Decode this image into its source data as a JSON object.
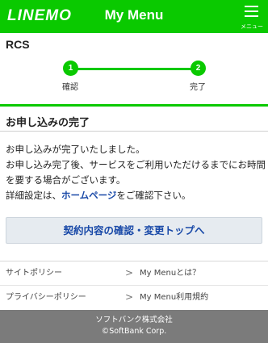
{
  "header": {
    "logo": "LINEMO",
    "title": "My Menu",
    "menu_label": "メニュー"
  },
  "service_name": "RCS",
  "stepper": {
    "steps": [
      {
        "number": "1",
        "label": "確認"
      },
      {
        "number": "2",
        "label": "完了"
      }
    ]
  },
  "section": {
    "title": "お申し込みの完了"
  },
  "body": {
    "line1": "お申し込みが完了いたしました。",
    "line2": "お申し込み完了後、サービスをご利用いただけるまでにお時間を要する場合がございます。",
    "line3_prefix": "詳細設定は、",
    "line3_link": "ホームページ",
    "line3_suffix": "をご確認下さい。"
  },
  "primary_button": "契約内容の確認・変更トップへ",
  "footer_links": [
    {
      "label": "サイトポリシー"
    },
    {
      "label": "My Menuとは？"
    },
    {
      "label": "プライバシーポリシー"
    },
    {
      "label": "My Menu利用規約"
    }
  ],
  "footer": {
    "company": "ソフトバンク株式会社",
    "copyright": "©SoftBank Corp."
  }
}
